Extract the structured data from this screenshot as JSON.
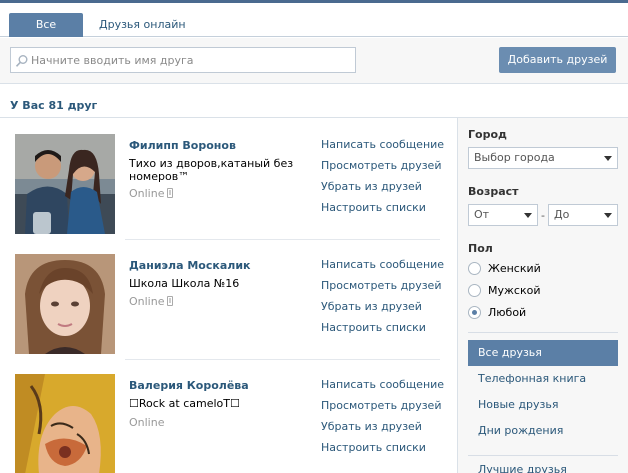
{
  "tabs": [
    {
      "label": "Все друзья",
      "active": true
    },
    {
      "label": "Друзья онлайн",
      "active": false
    }
  ],
  "search": {
    "placeholder": "Начните вводить имя друга",
    "icon": "search-icon"
  },
  "add_button_label": "Добавить друзей",
  "friend_count": "У Вас 81 друг",
  "friends": [
    {
      "name": "Филипп Воронов",
      "status": "Тихо из дворов,катаный без номеров™",
      "online": "Online",
      "mobile": true,
      "actions": [
        "Написать сообщение",
        "Просмотреть друзей",
        "Убрать из друзей",
        "Настроить списки"
      ]
    },
    {
      "name": "Даниэла Москалик",
      "status": "Школа Школа №16",
      "online": "Online",
      "mobile": true,
      "actions": [
        "Написать сообщение",
        "Просмотреть друзей",
        "Убрать из друзей",
        "Настроить списки"
      ]
    },
    {
      "name": "Валерия Королёва",
      "status": "☐Rock at cameloT☐",
      "online": "Online",
      "mobile": false,
      "actions": [
        "Написать сообщение",
        "Просмотреть друзей",
        "Убрать из друзей",
        "Настроить списки"
      ]
    }
  ],
  "filters": {
    "city_label": "Город",
    "city_value": "Выбор города",
    "age_label": "Возраст",
    "age_from": "От",
    "age_dash": "-",
    "age_to": "До",
    "gender_label": "Пол",
    "gender_options": [
      "Женский",
      "Мужской",
      "Любой"
    ],
    "gender_selected": "Любой"
  },
  "sidebar_menu": [
    {
      "label": "Все друзья",
      "active": true
    },
    {
      "label": "Телефонная книга",
      "active": false
    },
    {
      "label": "Новые друзья",
      "active": false
    },
    {
      "label": "Дни рождения",
      "active": false
    }
  ],
  "sidebar_last": "Лучшие друзья",
  "colors": {
    "accent": "#5b7fa6",
    "link": "#2b587a",
    "button": "#6b8db1"
  }
}
